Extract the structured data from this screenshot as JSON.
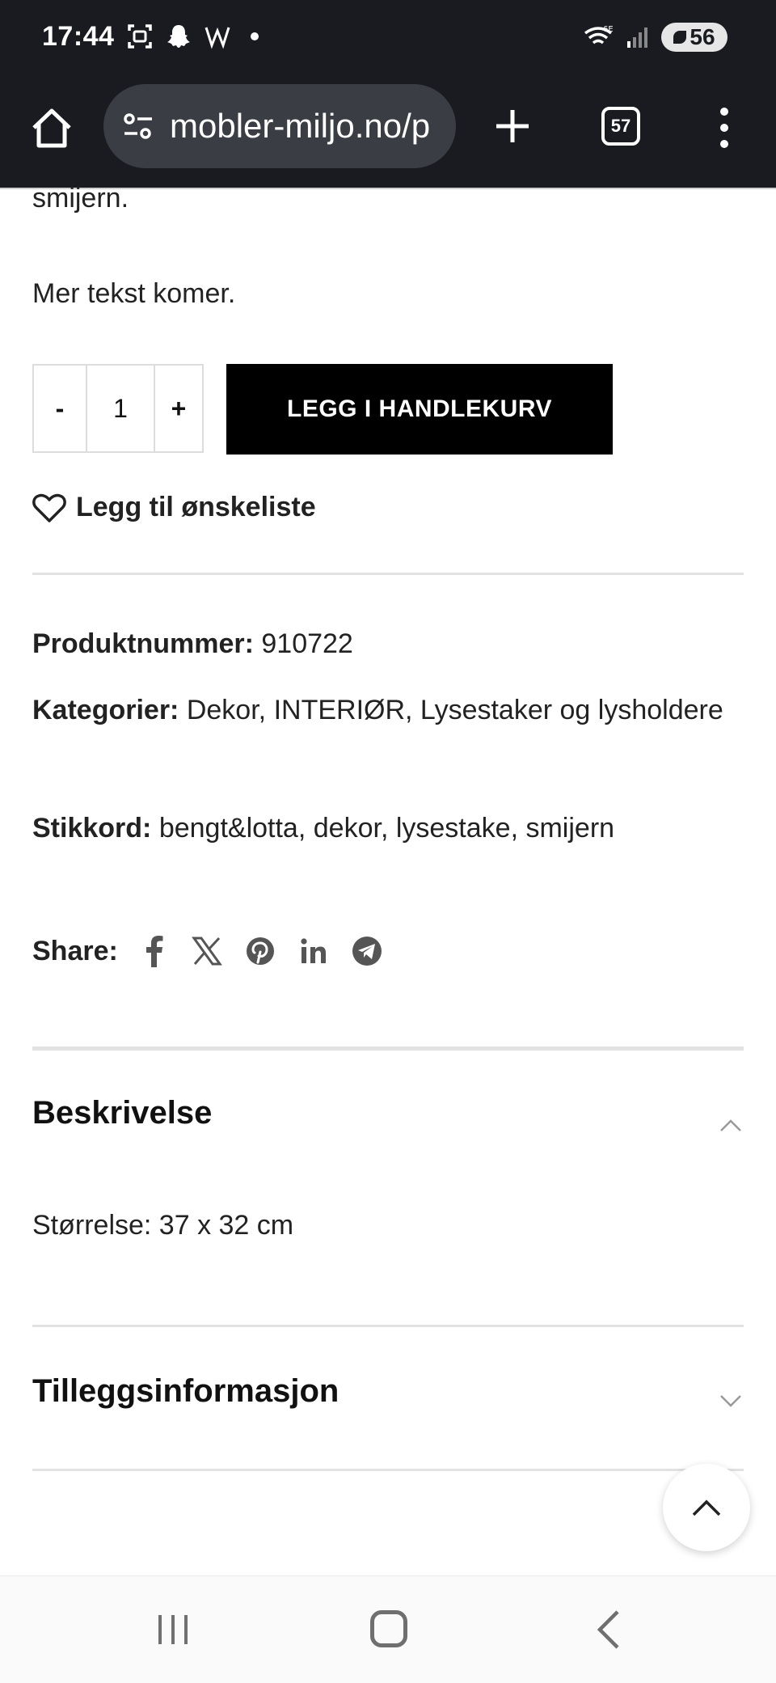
{
  "status_bar": {
    "time": "17:44",
    "battery": "56",
    "network": "6E"
  },
  "browser": {
    "url": "mobler-miljo.no/p",
    "tab_count": "57"
  },
  "product": {
    "intro_tail": "smijern.",
    "more_text": "Mer tekst komer.",
    "quantity": {
      "minus": "-",
      "value": "1",
      "plus": "+"
    },
    "add_to_cart": "LEGG I HANDLEKURV",
    "wishlist": "Legg til ønskeliste",
    "meta": {
      "sku_label": "Produktnummer:",
      "sku": "910722",
      "categories_label": "Kategorier:",
      "categories": [
        "Dekor",
        "INTERIØR",
        "Lysestaker og lysholdere"
      ],
      "tags_label": "Stikkord:",
      "tags": [
        "bengt&lotta",
        "dekor",
        "lysestake",
        "smijern"
      ]
    },
    "share_label": "Share:",
    "share_icons": [
      "facebook-icon",
      "x-icon",
      "pinterest-icon",
      "linkedin-icon",
      "telegram-icon"
    ]
  },
  "tabs": {
    "description": {
      "title": "Beskrivelse",
      "content": "Størrelse: 37 x 32 cm"
    },
    "additional": {
      "title": "Tilleggsinformasjon"
    }
  },
  "colors": {
    "bar": "#1a1b20",
    "button": "#000000",
    "divider": "#e2e2e2"
  }
}
